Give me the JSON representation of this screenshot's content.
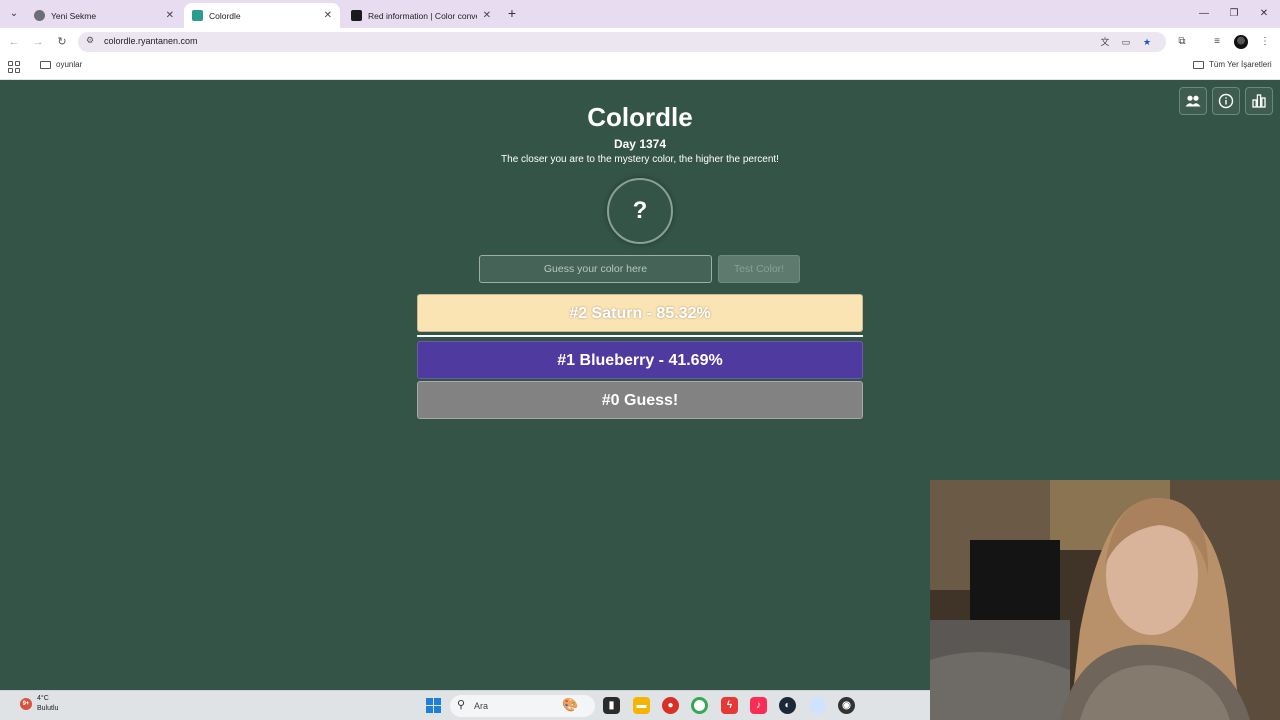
{
  "browser": {
    "tabs": [
      {
        "title": "Yeni Sekme",
        "active": false,
        "favicon_color": "#6b6f75"
      },
      {
        "title": "Colordle",
        "active": true,
        "favicon_color": "#2a9d8f"
      },
      {
        "title": "Red information | Color conver",
        "active": false,
        "favicon_color": "#1a1a1a"
      }
    ],
    "url": "colordle.ryantanen.com",
    "bookmark_folder": "oyunlar",
    "all_bookmarks": "Tüm Yer İşaretleri"
  },
  "game": {
    "title": "Colordle",
    "day": "Day 1374",
    "subtitle": "The closer you are to the mystery color, the higher the percent!",
    "mystery_symbol": "?",
    "input_placeholder": "Guess your color here",
    "test_button": "Test Color!",
    "guesses": [
      {
        "label": "#2 Saturn - 85.32%",
        "color": "#fbe4b4",
        "percent": 85.32
      },
      {
        "label": "#1 Blueberry - 41.69%",
        "color": "#4f3aa0",
        "percent": 41.69
      },
      {
        "label": "#0 Guess!",
        "color": "#828282"
      }
    ],
    "background_color": "#345448"
  },
  "taskbar": {
    "weather_badge": "9+",
    "temperature": "4°C",
    "condition": "Bulutlu",
    "search_label": "Ara"
  }
}
